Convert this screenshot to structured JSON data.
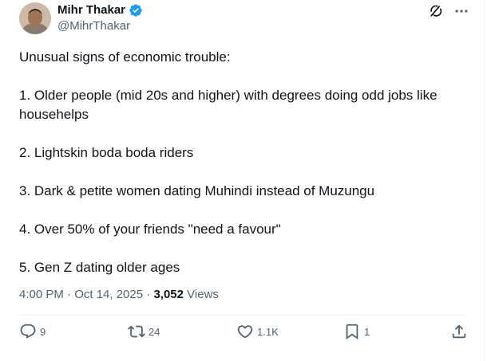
{
  "author": {
    "display_name": "Mihr Thakar",
    "handle": "@MihrThakar",
    "verified": true
  },
  "tweet": {
    "intro": "Unusual signs of economic trouble:",
    "items": [
      "1. Older people (mid 20s and higher) with degrees doing odd jobs like househelps",
      "2. Lightskin boda boda riders",
      "3. Dark & petite women dating Muhindi instead of Muzungu",
      "4. Over 50% of your friends \"need a favour\"",
      "5. Gen Z dating older ages"
    ]
  },
  "meta": {
    "timestamp": "4:00 PM · Oct 14, 2025",
    "separator": " · ",
    "views_count": "3,052",
    "views_label": "Views"
  },
  "actions": {
    "replies": "9",
    "reposts": "24",
    "likes": "1.1K",
    "bookmarks": "1"
  },
  "icons": {
    "verified": "verified-badge-icon",
    "grok": "grok-icon",
    "more": "more-icon",
    "reply": "reply-icon",
    "repost": "repost-icon",
    "like": "heart-icon",
    "bookmark": "bookmark-icon",
    "share": "share-icon"
  },
  "colors": {
    "verified_blue": "#1d9bf0",
    "text_primary": "#0f1419",
    "text_secondary": "#536471"
  }
}
